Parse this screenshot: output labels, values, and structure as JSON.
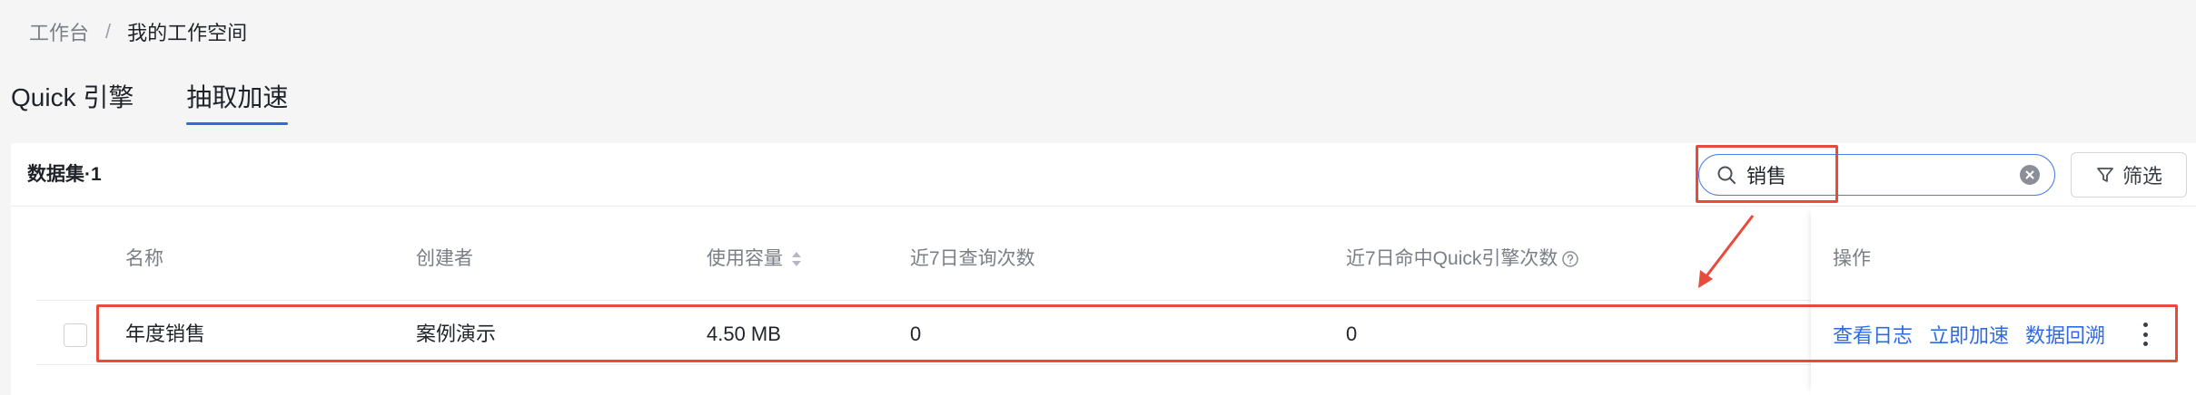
{
  "breadcrumb": {
    "parent": "工作台",
    "separator": "/",
    "current": "我的工作空间"
  },
  "tabs": [
    {
      "label": "Quick 引擎"
    },
    {
      "label": "抽取加速"
    }
  ],
  "toolbar": {
    "count_label": "数据集·1",
    "search_value": "销售",
    "filter_label": "筛选"
  },
  "table": {
    "columns": [
      "名称",
      "创建者",
      "使用容量",
      "近7日查询次数",
      "近7日命中Quick引擎次数",
      "操作"
    ],
    "rows": [
      {
        "name": "年度销售",
        "creator": "案例演示",
        "size": "4.50 MB",
        "queries": "0",
        "hits": "0"
      }
    ],
    "actions": [
      "查看日志",
      "立即加速",
      "数据回溯"
    ]
  },
  "icons": {
    "search": "search-icon",
    "clear": "clear-icon",
    "filter": "filter-icon",
    "sort": "sort-icon",
    "help": "help-icon",
    "more": "more-vertical-icon"
  },
  "colors": {
    "accent": "#2f6ae5",
    "highlight": "#e84a3c"
  }
}
